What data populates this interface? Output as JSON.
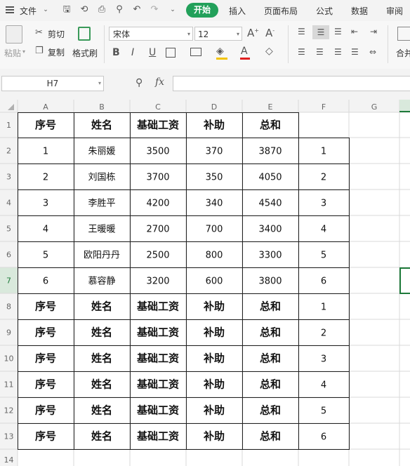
{
  "menu": {
    "file_label": "文件",
    "tabs": [
      {
        "label": "开始",
        "active": true
      },
      {
        "label": "插入",
        "active": false
      },
      {
        "label": "页面布局",
        "active": false
      },
      {
        "label": "公式",
        "active": false
      },
      {
        "label": "数据",
        "active": false
      },
      {
        "label": "审阅",
        "active": false
      }
    ]
  },
  "ribbon": {
    "paste_label": "粘贴",
    "cut_label": "剪切",
    "copy_label": "复制",
    "format_painter_label": "格式刷",
    "font_name": "宋体",
    "font_size": "12",
    "merge_label": "合并",
    "bold": "B",
    "italic": "I",
    "underline": "U"
  },
  "formula_bar": {
    "cell_ref": "H7",
    "fx_label": "fx",
    "formula": ""
  },
  "sheet": {
    "columns": [
      "A",
      "B",
      "C",
      "D",
      "E",
      "F",
      "G"
    ],
    "rows": [
      "1",
      "2",
      "3",
      "4",
      "5",
      "6",
      "7",
      "8",
      "9",
      "10",
      "11",
      "12",
      "13",
      "14"
    ],
    "selected_row": "7",
    "selected_cell": "H7",
    "cells": [
      [
        "序号",
        "姓名",
        "基础工资",
        "补助",
        "总和",
        ""
      ],
      [
        "1",
        "朱丽媛",
        "3500",
        "370",
        "3870",
        "1"
      ],
      [
        "2",
        "刘国栋",
        "3700",
        "350",
        "4050",
        "2"
      ],
      [
        "3",
        "李胜平",
        "4200",
        "340",
        "4540",
        "3"
      ],
      [
        "4",
        "王暖暖",
        "2700",
        "700",
        "3400",
        "4"
      ],
      [
        "5",
        "欧阳丹丹",
        "2500",
        "800",
        "3300",
        "5"
      ],
      [
        "6",
        "慕容静",
        "3200",
        "600",
        "3800",
        "6"
      ],
      [
        "序号",
        "姓名",
        "基础工资",
        "补助",
        "总和",
        "1"
      ],
      [
        "序号",
        "姓名",
        "基础工资",
        "补助",
        "总和",
        "2"
      ],
      [
        "序号",
        "姓名",
        "基础工资",
        "补助",
        "总和",
        "3"
      ],
      [
        "序号",
        "姓名",
        "基础工资",
        "补助",
        "总和",
        "4"
      ],
      [
        "序号",
        "姓名",
        "基础工资",
        "补助",
        "总和",
        "5"
      ],
      [
        "序号",
        "姓名",
        "基础工资",
        "补助",
        "总和",
        "6"
      ],
      [
        "",
        "",
        "",
        "",
        "",
        ""
      ]
    ],
    "bold_rows": [
      0,
      7,
      8,
      9,
      10,
      11,
      12
    ]
  },
  "colors": {
    "accent": "#22a05a",
    "selection": "#1e7a3a",
    "header_bg": "#f3f3f3"
  }
}
